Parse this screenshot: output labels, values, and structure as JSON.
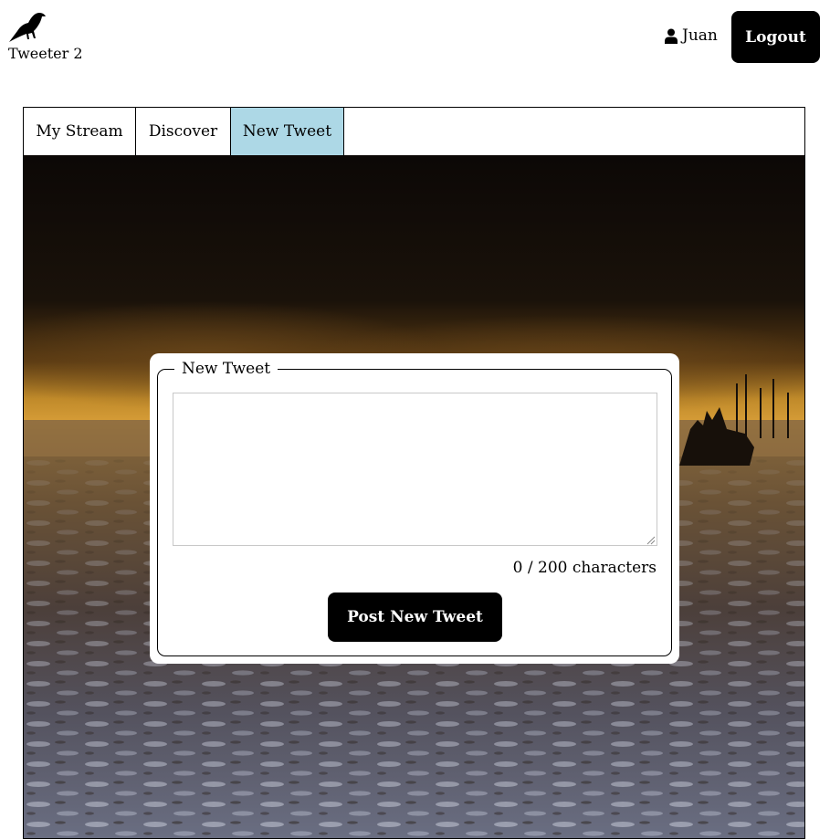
{
  "app": {
    "name": "Tweeter 2",
    "logo_icon": "crow-icon"
  },
  "user": {
    "icon": "user-icon",
    "name": "Juan",
    "logout_label": "Logout"
  },
  "tabs": [
    {
      "label": "My Stream",
      "active": false
    },
    {
      "label": "Discover",
      "active": false
    },
    {
      "label": "New Tweet",
      "active": true
    }
  ],
  "composer": {
    "legend": "New Tweet",
    "value": "",
    "counter": "0 / 200 characters",
    "post_label": "Post New Tweet"
  },
  "colors": {
    "active_tab": "#add8e6",
    "button": "#000000"
  }
}
